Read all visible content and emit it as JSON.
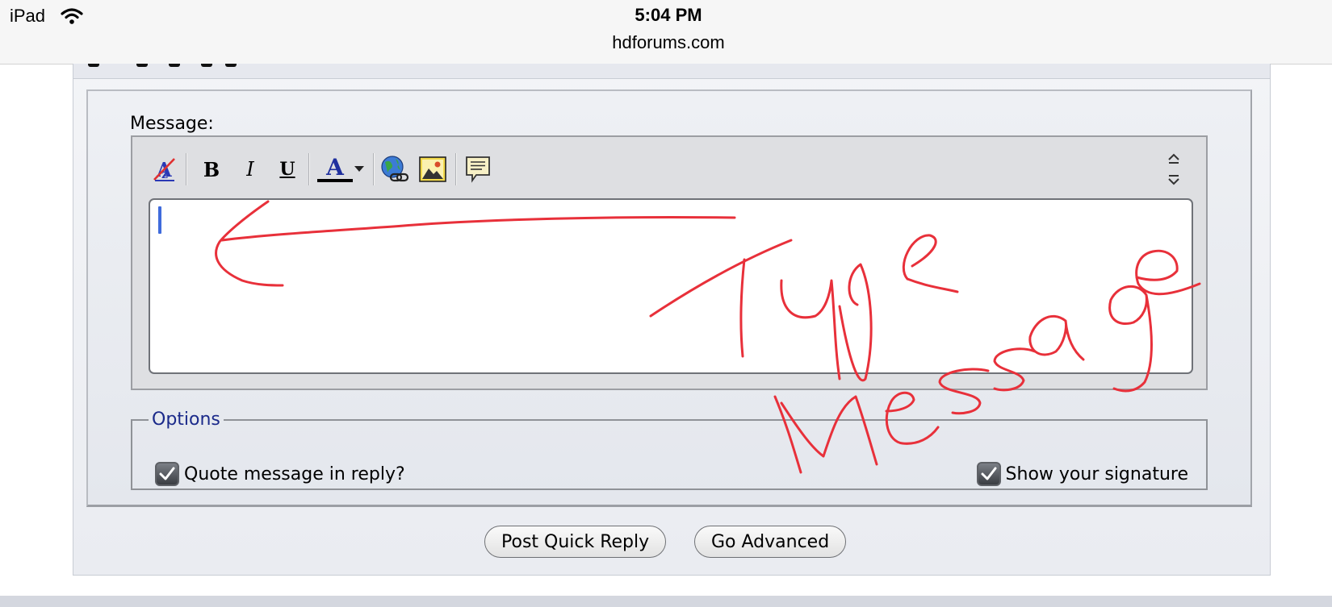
{
  "status_bar": {
    "device": "iPad",
    "time": "5:04 PM",
    "url": "hdforums.com"
  },
  "form": {
    "message_label": "Message:",
    "toolbar": {
      "remove_format_icon": "remove-format-icon",
      "bold_label": "B",
      "italic_label": "I",
      "underline_label": "U",
      "font_color_label": "A",
      "font_color_swatch": "#000000"
    },
    "message_value": "",
    "options": {
      "legend": "Options",
      "quote_label": "Quote message in reply?",
      "quote_checked": true,
      "signature_label": "Show your signature",
      "signature_checked": true
    },
    "buttons": {
      "post_label": "Post Quick Reply",
      "advanced_label": "Go Advanced"
    }
  },
  "annotation": {
    "text": "Type Message",
    "color": "#e8303a"
  }
}
